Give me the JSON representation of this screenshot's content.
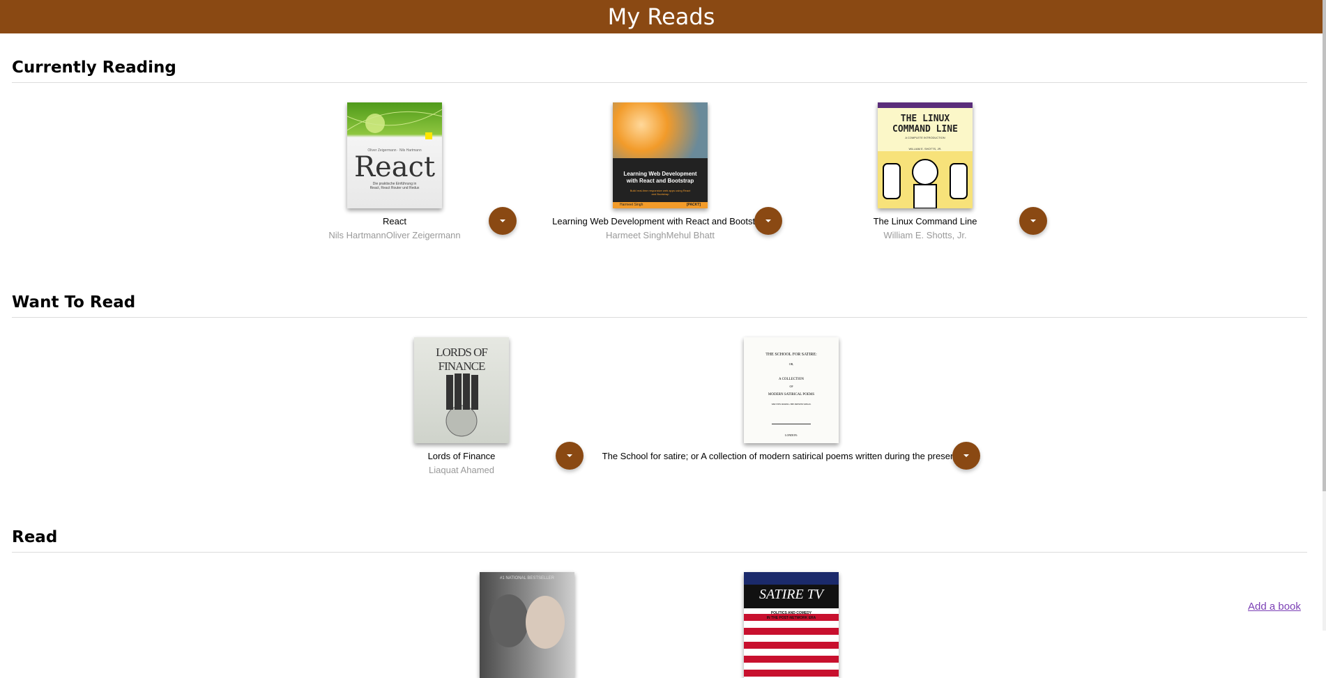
{
  "app": {
    "title": "My Reads"
  },
  "shelves": [
    {
      "title": "Currently Reading",
      "books": [
        {
          "title": "React",
          "authors": "Nils HartmannOliver Zeigermann",
          "cover": {
            "top_line": "Oliver Zeigermann · Nils Hartmann",
            "big_text": "React",
            "sub_text_1": "Die praktische Einführung in",
            "sub_text_2": "React, React Router und Redux"
          }
        },
        {
          "title": "Learning Web Development with React and Bootstrap",
          "authors": "Harmeet SinghMehul Bhatt",
          "cover": {
            "heading_1": "Learning Web Development",
            "heading_2": "with React and Bootstrap",
            "sub_text_1": "Build real-time responsive web apps using React",
            "sub_text_2": "and Bootstrap",
            "footer_left": "Harmeet Singh",
            "footer_right": "[PACKT]"
          }
        },
        {
          "title": "The Linux Command Line",
          "authors": "William E. Shotts, Jr.",
          "cover": {
            "heading_1": "THE LINUX",
            "heading_2": "COMMAND LINE",
            "sub_text": "A COMPLETE INTRODUCTION",
            "author_line": "WILLIAM E. SHOTTS, JR."
          }
        }
      ]
    },
    {
      "title": "Want To Read",
      "books": [
        {
          "title": "Lords of Finance",
          "authors": "Liaquat Ahamed",
          "cover": {
            "heading": "LORDS OF FINANCE"
          }
        },
        {
          "title": "The School for satire; or A collection of modern satirical poems written during the present reign",
          "authors": "",
          "cover": {
            "line_1": "THE SCHOOL FOR SATIRE:",
            "line_2": "OR,",
            "line_3": "A COLLECTION",
            "line_4": "OF",
            "line_5": "MODERN SATIRICAL POEMS",
            "line_6": "WRITTEN DURING THE PRESENT REIGN.",
            "line_7": "LONDON:"
          }
        }
      ]
    },
    {
      "title": "Read",
      "books": [
        {
          "cover": {
            "top_line": "#1 NATIONAL BESTSELLER"
          }
        },
        {
          "cover": {
            "heading": "SATIRE TV",
            "sub_text_1": "POLITICS AND COMEDY",
            "sub_text_2": "IN THE POST-NETWORK ERA"
          }
        }
      ]
    }
  ],
  "add_book": {
    "label": "Add a book"
  },
  "colors": {
    "header": "#8a4913",
    "changer": "#8a4913",
    "link": "#7b3fb5"
  }
}
